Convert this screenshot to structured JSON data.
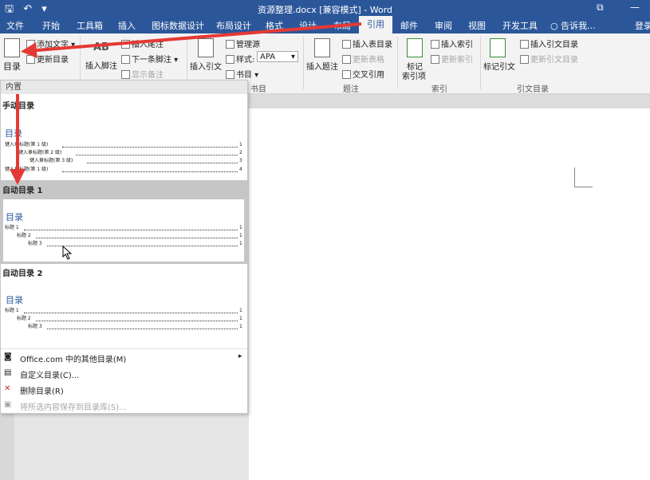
{
  "titlebar": {
    "quick_access": "🖫 ↶ ▾",
    "title": "资源整理.docx [兼容模式] - Word",
    "restore": "⧉",
    "minimize": "—"
  },
  "tabs": [
    {
      "label": "文件"
    },
    {
      "label": "开始"
    },
    {
      "label": "工具箱"
    },
    {
      "label": "插入"
    },
    {
      "label": "图标数据设计"
    },
    {
      "label": "布局设计"
    },
    {
      "label": "格式"
    },
    {
      "label": "设计"
    },
    {
      "label": "布局"
    },
    {
      "label": "引用"
    },
    {
      "label": "邮件"
    },
    {
      "label": "审阅"
    },
    {
      "label": "视图"
    },
    {
      "label": "开发工具"
    },
    {
      "label": "告诉我..."
    },
    {
      "label": "登录"
    }
  ],
  "ribbon": {
    "toc_button": "目录",
    "add_text": "添加文字 ▾",
    "update_toc": "更新目录",
    "insert_footnote": "插入脚注",
    "footnote_ab": "AB",
    "insert_endnote": "插入尾注",
    "next_footnote": "下一条脚注 ▾",
    "show_notes": "显示备注",
    "insert_citation": "插入引文",
    "manage_sources": "管理源",
    "style_label": "样式:",
    "style_value": "APA",
    "bibliography": "书目 ▾",
    "insert_caption": "插入题注",
    "insert_table_of_figures": "插入表目录",
    "update_table": "更新表格",
    "cross_reference": "交叉引用",
    "mark_entry": "标记",
    "mark_entry2": "索引项",
    "insert_index": "插入索引",
    "update_index": "更新索引",
    "mark_citation": "标记引文",
    "insert_toa": "插入引文目录",
    "update_toa": "更新引文目录",
    "groups": {
      "captions": "题注",
      "index": "索引",
      "toa": "引文目录",
      "citations": "书目"
    }
  },
  "dropdown": {
    "builtin_header": "内置",
    "manual": {
      "label": "手动目录",
      "title": "目录",
      "lines": [
        {
          "text": "键入章标题(第 1 级)",
          "page": "1"
        },
        {
          "text": "键入章标题(第 2 级)",
          "page": "2"
        },
        {
          "text": "键入章标题(第 3 级)",
          "page": "3"
        },
        {
          "text": "键入章标题(第 1 级)",
          "page": "4"
        }
      ]
    },
    "auto1": {
      "label": "自动目录 1",
      "title": "目录",
      "lines": [
        {
          "text": "标题 1",
          "page": "1"
        },
        {
          "text": "标题 2",
          "page": "1"
        },
        {
          "text": "标题 3",
          "page": "1"
        }
      ]
    },
    "auto2": {
      "label": "自动目录 2",
      "title": "目录",
      "lines": [
        {
          "text": "标题 1",
          "page": "1"
        },
        {
          "text": "标题 2",
          "page": "1"
        },
        {
          "text": "标题 3",
          "page": "1"
        }
      ]
    },
    "menu": [
      {
        "label": "Office.com 中的其他目录(M)",
        "submenu": "▸"
      },
      {
        "label": "自定义目录(C)..."
      },
      {
        "label": "删除目录(R)"
      },
      {
        "label": "将所选内容保存到目录库(S)..."
      }
    ]
  },
  "colors": {
    "accent": "#2b579a",
    "arrow": "#e53935",
    "highlight": "#c6c6c6"
  }
}
